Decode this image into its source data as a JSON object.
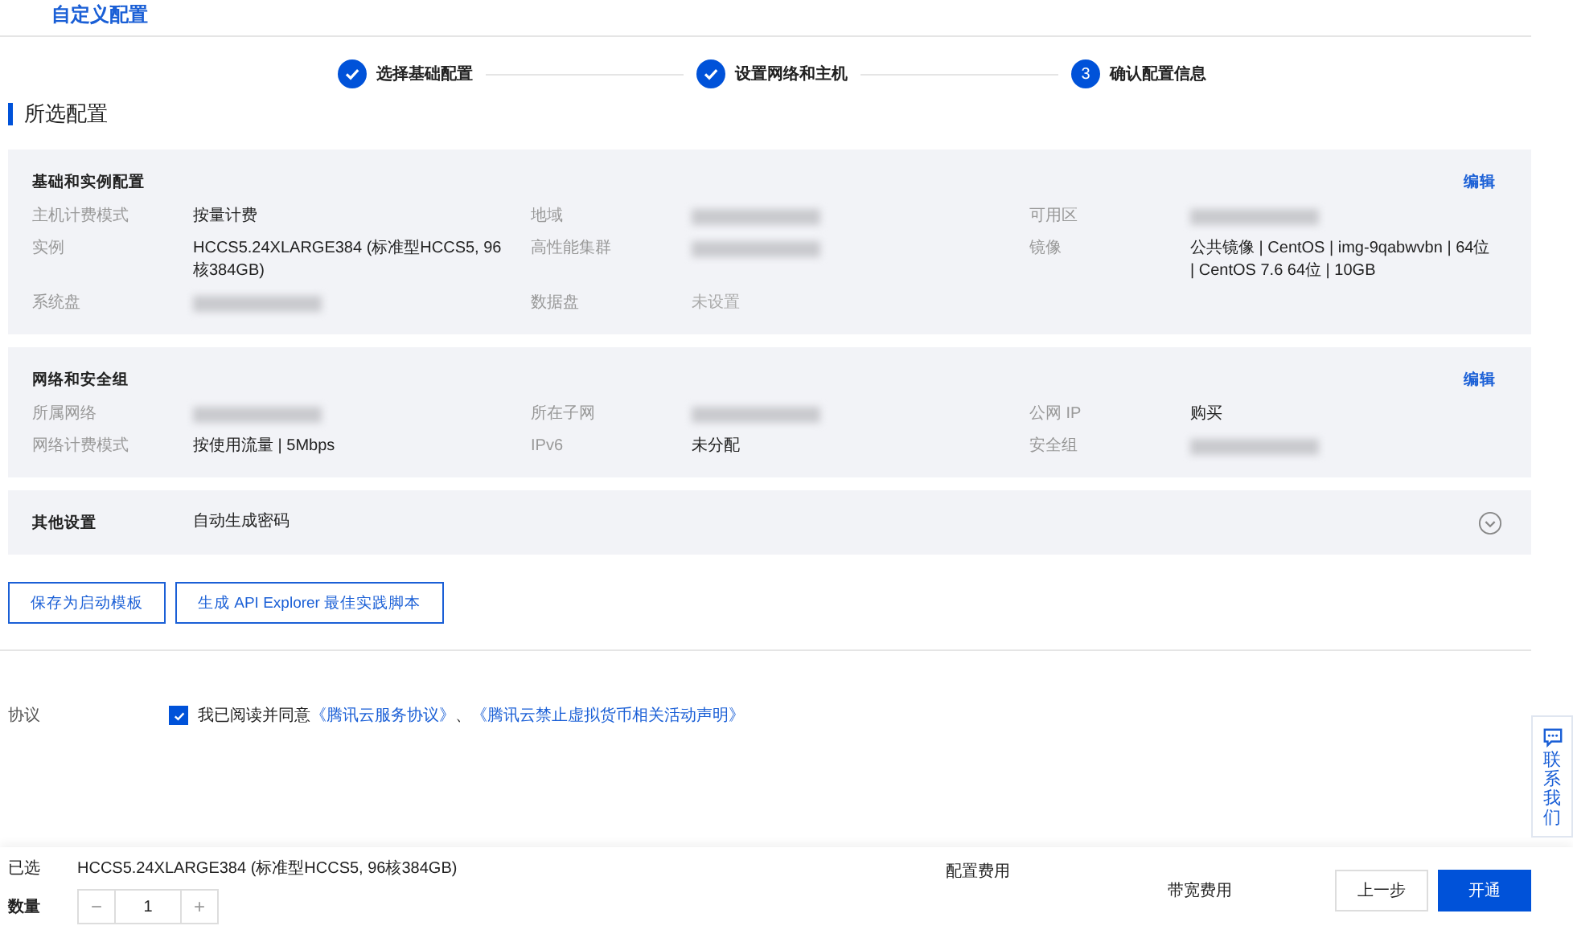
{
  "header": {
    "title": "自定义配置"
  },
  "steps": [
    {
      "label": "选择基础配置",
      "done": true
    },
    {
      "label": "设置网络和主机",
      "done": true
    },
    {
      "label": "确认配置信息",
      "number": "3",
      "done": false
    }
  ],
  "section_title": "所选配置",
  "panels": [
    {
      "title": "基础和实例配置",
      "edit": "编辑",
      "fields": [
        {
          "label": "主机计费模式",
          "value": "按量计费",
          "kind": "text"
        },
        {
          "label": "地域",
          "kind": "blurred"
        },
        {
          "label": "可用区",
          "kind": "blurred"
        },
        {
          "label": "实例",
          "value": "HCCS5.24XLARGE384 (标准型HCCS5, 96核384GB)",
          "kind": "text"
        },
        {
          "label": "高性能集群",
          "kind": "blurred"
        },
        {
          "label": "镜像",
          "value": "公共镜像 | CentOS | img-9qabwvbn | 64位 | CentOS 7.6 64位 | 10GB",
          "kind": "text"
        },
        {
          "label": "系统盘",
          "kind": "blurred"
        },
        {
          "label": "数据盘",
          "value": "未设置",
          "kind": "muted"
        }
      ]
    },
    {
      "title": "网络和安全组",
      "edit": "编辑",
      "fields": [
        {
          "label": "所属网络",
          "kind": "blurred"
        },
        {
          "label": "所在子网",
          "kind": "blurred"
        },
        {
          "label": "公网 IP",
          "value": "购买",
          "kind": "text"
        },
        {
          "label": "网络计费模式",
          "value": "按使用流量 | 5Mbps",
          "kind": "text"
        },
        {
          "label": "IPv6",
          "value": "未分配",
          "kind": "text"
        },
        {
          "label": "安全组",
          "kind": "blurred"
        }
      ]
    }
  ],
  "other_settings": {
    "label": "其他设置",
    "value": "自动生成密码",
    "expanded": false
  },
  "actions": [
    "保存为启动模板",
    "生成 API Explorer 最佳实践脚本"
  ],
  "agreement": {
    "label": "协议",
    "checked": true,
    "text": "我已阅读并同意",
    "links": [
      "《腾讯云服务协议》",
      "《腾讯云禁止虚拟货币相关活动声明》"
    ],
    "separator": "、"
  },
  "contact": {
    "label": "联系我们"
  },
  "footer": {
    "selected_label": "已选",
    "selected_value": "HCCS5.24XLARGE384 (标准型HCCS5, 96核384GB)",
    "quantity_label": "数量",
    "quantity": "1",
    "minus": "−",
    "plus": "+",
    "config_fee_label": "配置费用",
    "bandwidth_fee_label": "带宽费用",
    "buttons": [
      {
        "label": "上一步",
        "kind": "secondary"
      },
      {
        "label": "开通",
        "kind": "primary"
      }
    ]
  }
}
